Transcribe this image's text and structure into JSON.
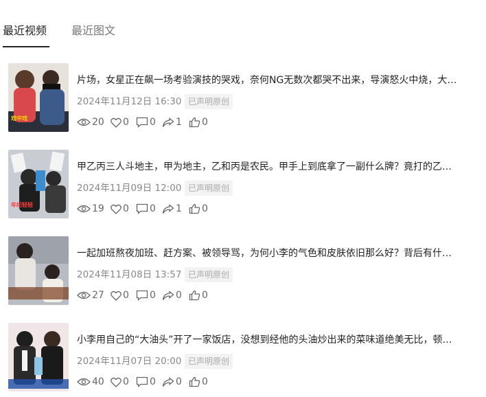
{
  "tabs": [
    {
      "label": "最近视频"
    },
    {
      "label": "最近图文"
    }
  ],
  "videos": [
    {
      "title": "片场，女星正在飙一场考验演技的哭戏，奈何NG无数次都哭不出来，导演怒火中烧，大…",
      "date": "2024年11月12日 16:30",
      "badge": "已声明原创",
      "thumb_text": "戏中戏",
      "stats": {
        "views": "20",
        "likes": "0",
        "comments": "0",
        "shares": "1",
        "thumbs": "0"
      }
    },
    {
      "title": "甲乙丙三人斗地主，甲为地主，乙和丙是农民。甲手上到底拿了一副什么牌？竟打的乙丙…",
      "date": "2024年11月09日 12:00",
      "badge": "已声明原创",
      "thumb_text": "年纪轻轻",
      "stats": {
        "views": "19",
        "likes": "0",
        "comments": "0",
        "shares": "1",
        "thumbs": "0"
      }
    },
    {
      "title": "一起加班熬夜加班、赶方案、被领导骂，为何小李的气色和皮肤依旧那么好？背后有什么…",
      "date": "2024年11月08日 13:57",
      "badge": "已声明原创",
      "thumb_text": "",
      "stats": {
        "views": "27",
        "likes": "0",
        "comments": "0",
        "shares": "0",
        "thumbs": "0"
      }
    },
    {
      "title": "小李用自己的“大油头”开了一家饭店，没想到经他的头油炒出来的菜味道绝美无比，顿时…",
      "date": "2024年11月07日 20:00",
      "badge": "已声明原创",
      "thumb_text": "",
      "stats": {
        "views": "40",
        "likes": "0",
        "comments": "0",
        "shares": "0",
        "thumbs": "0"
      }
    }
  ],
  "colors": {
    "text": "#222222",
    "muted": "#888888",
    "badge_bg": "#f3f3f3",
    "icon": "#666666"
  }
}
